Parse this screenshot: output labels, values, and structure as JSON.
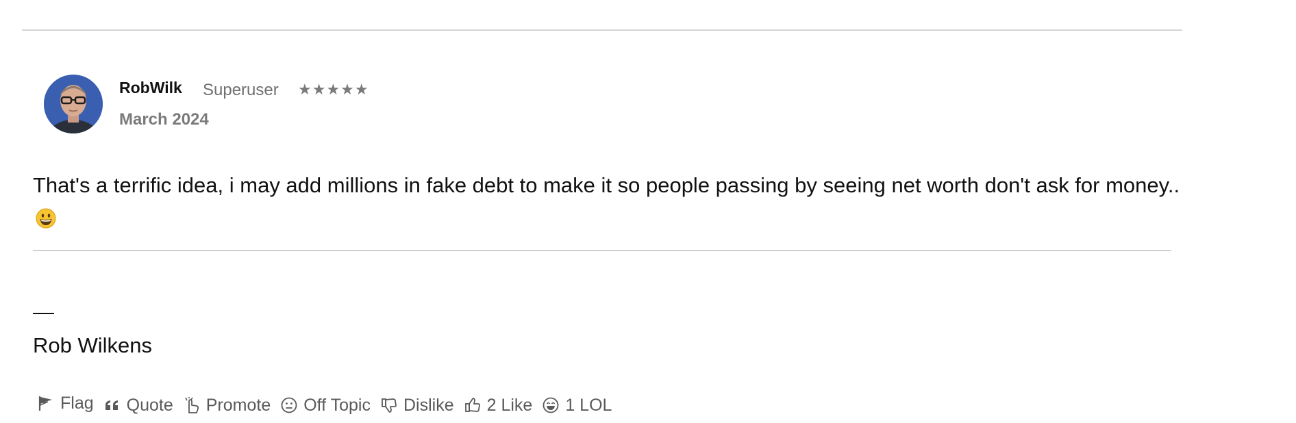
{
  "comment": {
    "author": {
      "name": "RobWilk",
      "rank": "Superuser",
      "stars": "★★★★★"
    },
    "date": "March 2024",
    "body": "That's a terrific idea, i may add millions in fake debt to make it so people passing by seeing net worth don't ask for money..",
    "body_emoji": "grinning-face-emoji",
    "signature": {
      "dash": "—",
      "name": "Rob Wilkens"
    },
    "reactions": [
      {
        "label": "Flag",
        "icon": "flag-icon"
      },
      {
        "label": "Quote",
        "icon": "quote-icon"
      },
      {
        "label": "Promote",
        "icon": "promote-icon"
      },
      {
        "label": "Off Topic",
        "icon": "off-topic-icon"
      },
      {
        "label": "Dislike",
        "icon": "thumbs-down-icon"
      },
      {
        "label": "2 Like",
        "icon": "thumbs-up-icon"
      },
      {
        "label": "1 LOL",
        "icon": "lol-icon"
      }
    ]
  },
  "colors": {
    "text": "#111111",
    "muted": "#6f6f6f",
    "rule": "#d4d4d4",
    "avatar_bg": "#3b5fb0"
  }
}
